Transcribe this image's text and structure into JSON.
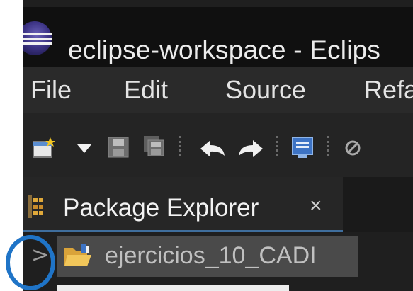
{
  "window": {
    "title": "eclipse-workspace - Eclips"
  },
  "menu": {
    "items": [
      "File",
      "Edit",
      "Source",
      "Refa"
    ]
  },
  "toolbar": {
    "icons": [
      "new-icon",
      "dropdown-arrow-icon",
      "save-icon",
      "save-all-icon",
      "back-icon",
      "forward-icon",
      "console-icon",
      "skip-breakpoints-icon"
    ]
  },
  "view": {
    "tab_label": "Package Explorer",
    "close_glyph": "×"
  },
  "tree": {
    "expander_glyph": ">",
    "project_name": "ejercicios_10_CADI"
  },
  "colors": {
    "annotation_circle": "#1f74c7",
    "tab_accent": "#3f6e9d"
  }
}
